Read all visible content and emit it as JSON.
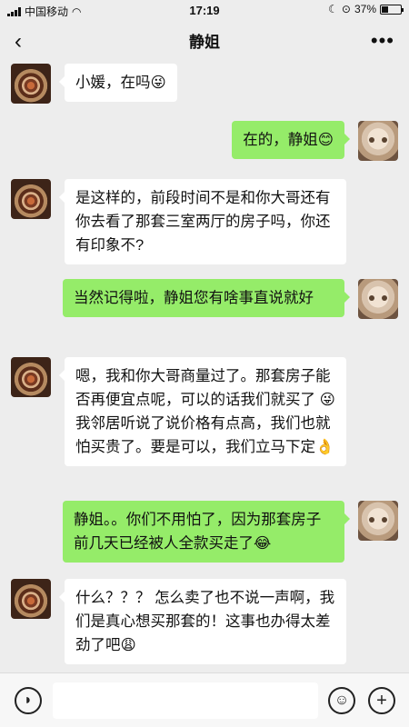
{
  "status_bar": {
    "carrier": "中国移动",
    "time": "17:19",
    "battery_percent": "37%",
    "battery_level": 0.37
  },
  "header": {
    "title": "静姐",
    "back_icon": "chevron-left-icon",
    "more_icon": "more-horizontal-icon"
  },
  "messages": [
    {
      "side": "left",
      "text": "小媛，在吗😜"
    },
    {
      "side": "right",
      "text": "在的，静姐😊"
    },
    {
      "side": "left",
      "text": "是这样的，前段时间不是和你大哥还有你去看了那套三室两厅的房子吗，你还有印象不?"
    },
    {
      "side": "right",
      "text": "当然记得啦，静姐您有啥事直说就好"
    },
    {
      "side": "left",
      "text": "嗯，我和你大哥商量过了。那套房子能否再便宜点呢，可以的话我们就买了 😜我邻居听说了说价格有点高，我们也就怕买贵了。要是可以，我们立马下定👌"
    },
    {
      "side": "right",
      "text": "静姐。。你们不用怕了，因为那套房子前几天已经被人全款买走了😂"
    },
    {
      "side": "left",
      "text": "什么？？？ 怎么卖了也不说一声啊，我们是真心想买那套的！这事也办得太差劲了吧😩"
    }
  ],
  "input_bar": {
    "voice_icon": "voice-icon",
    "emoji_icon": "emoji-icon",
    "plus_icon": "plus-icon",
    "emoji_glyph": "☺",
    "plus_glyph": "+",
    "voice_glyph": "◗"
  },
  "colors": {
    "background": "#ededed",
    "sent_bubble": "#95ec69",
    "received_bubble": "#ffffff"
  }
}
